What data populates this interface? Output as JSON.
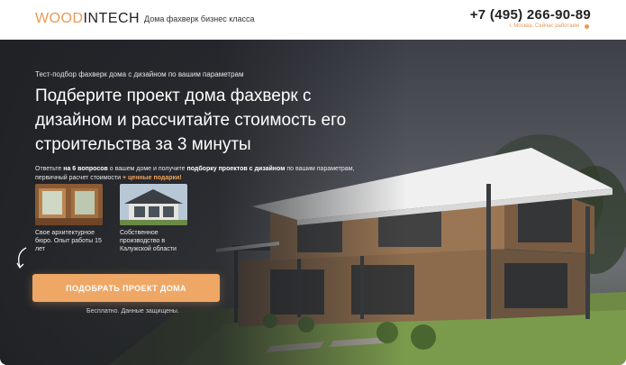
{
  "header": {
    "logo_part1": "WOOD",
    "logo_part2": "INTECH",
    "tagline": "Дома фахверк бизнес класса",
    "phone": "+7 (495) 266-90-89",
    "city_status": "г. Москва. Сейчас работаем"
  },
  "hero": {
    "pretitle": "Тест-подбор фахверк дома с дизайном по вашим параметрам",
    "title": "Подберите проект дома фахверк с дизайном и рассчитайте стоимость его строительства за 3 минуты",
    "desc_part1": "Ответьте ",
    "desc_bold1": "на 6 вопросов",
    "desc_part2": " о вашем доме и получите ",
    "desc_bold2": "подборку проектов с дизайном",
    "desc_part3": " по вашим параметрам, первичный расчет стоимости ",
    "desc_orange": "+ ценные подарки!",
    "features": [
      {
        "caption": "Свое архитектурное бюро. Опыт работы 15 лет"
      },
      {
        "caption": "Собственное производство в Калужской области"
      }
    ],
    "cta_label": "ПОДОБРАТЬ ПРОЕКТ ДОМА",
    "note": "Бесплатно. Данные защищены."
  },
  "colors": {
    "accent": "#eea765",
    "brand_orange": "#e89a55",
    "dark_overlay": "#1e2024"
  },
  "icons": {
    "status_dot": "dot-icon",
    "arrow": "curved-arrow-icon"
  }
}
